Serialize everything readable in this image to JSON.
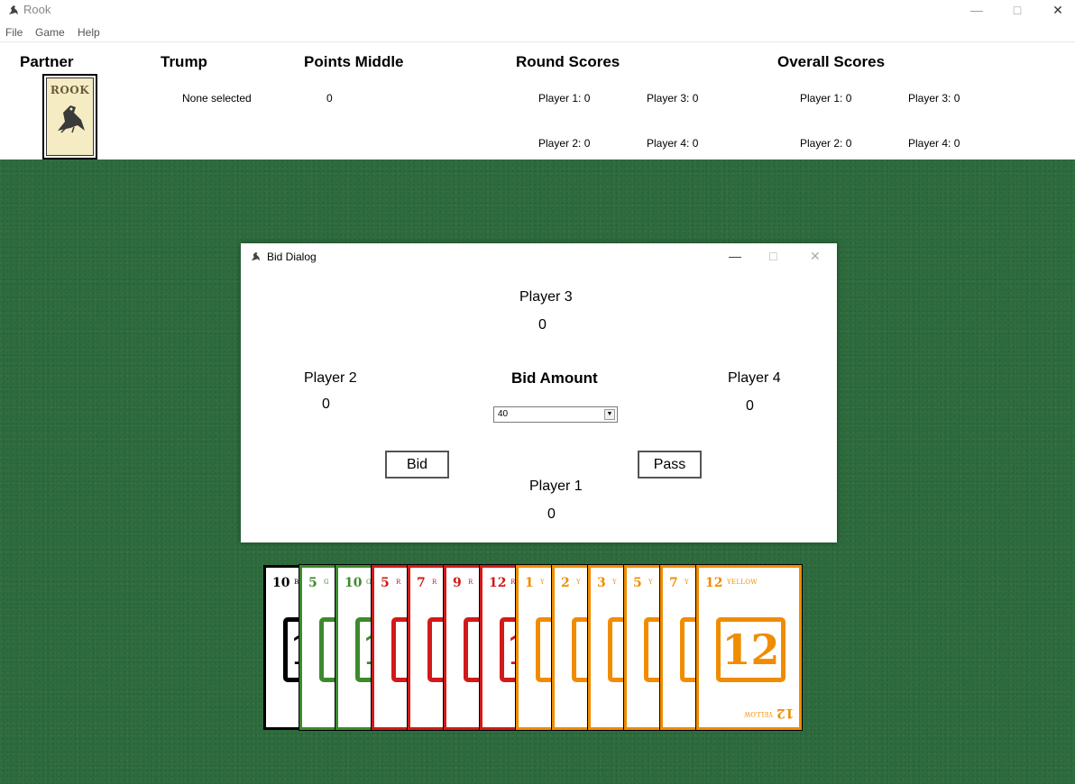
{
  "window": {
    "title": "Rook"
  },
  "menu": [
    "File",
    "Game",
    "Help"
  ],
  "header": {
    "partner_label": "Partner",
    "partner_card_text": "ROOK",
    "trump_label": "Trump",
    "trump_value": "None selected",
    "points_middle_label": "Points Middle",
    "points_middle_value": "0",
    "round_scores_label": "Round Scores",
    "round_scores": [
      "Player 1: 0",
      "Player 3: 0",
      "Player 2: 0",
      "Player 4: 0"
    ],
    "overall_scores_label": "Overall Scores",
    "overall_scores": [
      "Player 1: 0",
      "Player 3: 0",
      "Player 2: 0",
      "Player 4: 0"
    ]
  },
  "dialog": {
    "title": "Bid Dialog",
    "player3": {
      "label": "Player 3",
      "value": "0"
    },
    "player2": {
      "label": "Player 2",
      "value": "0"
    },
    "player4": {
      "label": "Player 4",
      "value": "0"
    },
    "player1": {
      "label": "Player 1",
      "value": "0"
    },
    "bid_amount_label": "Bid Amount",
    "bid_amount_selected": "40",
    "bid_button": "Bid",
    "pass_button": "Pass"
  },
  "colors": {
    "black": "#000000",
    "green": "#3d8a2e",
    "red": "#d11a1a",
    "yellow": "#f08c00",
    "felt": "#2d6b3d"
  },
  "hand": [
    {
      "rank": "10",
      "suit": "BLACK",
      "abbr": "B",
      "color": "#000000"
    },
    {
      "rank": "5",
      "suit": "GREEN",
      "abbr": "G",
      "color": "#3d8a2e"
    },
    {
      "rank": "10",
      "suit": "GREEN",
      "abbr": "G",
      "color": "#3d8a2e"
    },
    {
      "rank": "5",
      "suit": "RED",
      "abbr": "R",
      "color": "#d11a1a"
    },
    {
      "rank": "7",
      "suit": "RED",
      "abbr": "R",
      "color": "#d11a1a"
    },
    {
      "rank": "9",
      "suit": "RED",
      "abbr": "R",
      "color": "#d11a1a"
    },
    {
      "rank": "12",
      "suit": "RED",
      "abbr": "R",
      "color": "#d11a1a"
    },
    {
      "rank": "1",
      "suit": "YELLOW",
      "abbr": "Y",
      "color": "#f08c00"
    },
    {
      "rank": "2",
      "suit": "YELLOW",
      "abbr": "Y",
      "color": "#f08c00"
    },
    {
      "rank": "3",
      "suit": "YELLOW",
      "abbr": "Y",
      "color": "#f08c00"
    },
    {
      "rank": "5",
      "suit": "YELLOW",
      "abbr": "Y",
      "color": "#f08c00"
    },
    {
      "rank": "7",
      "suit": "YELLOW",
      "abbr": "Y",
      "color": "#f08c00"
    },
    {
      "rank": "12",
      "suit": "YELLOW",
      "abbr": "YELLOW",
      "color": "#f08c00"
    }
  ]
}
